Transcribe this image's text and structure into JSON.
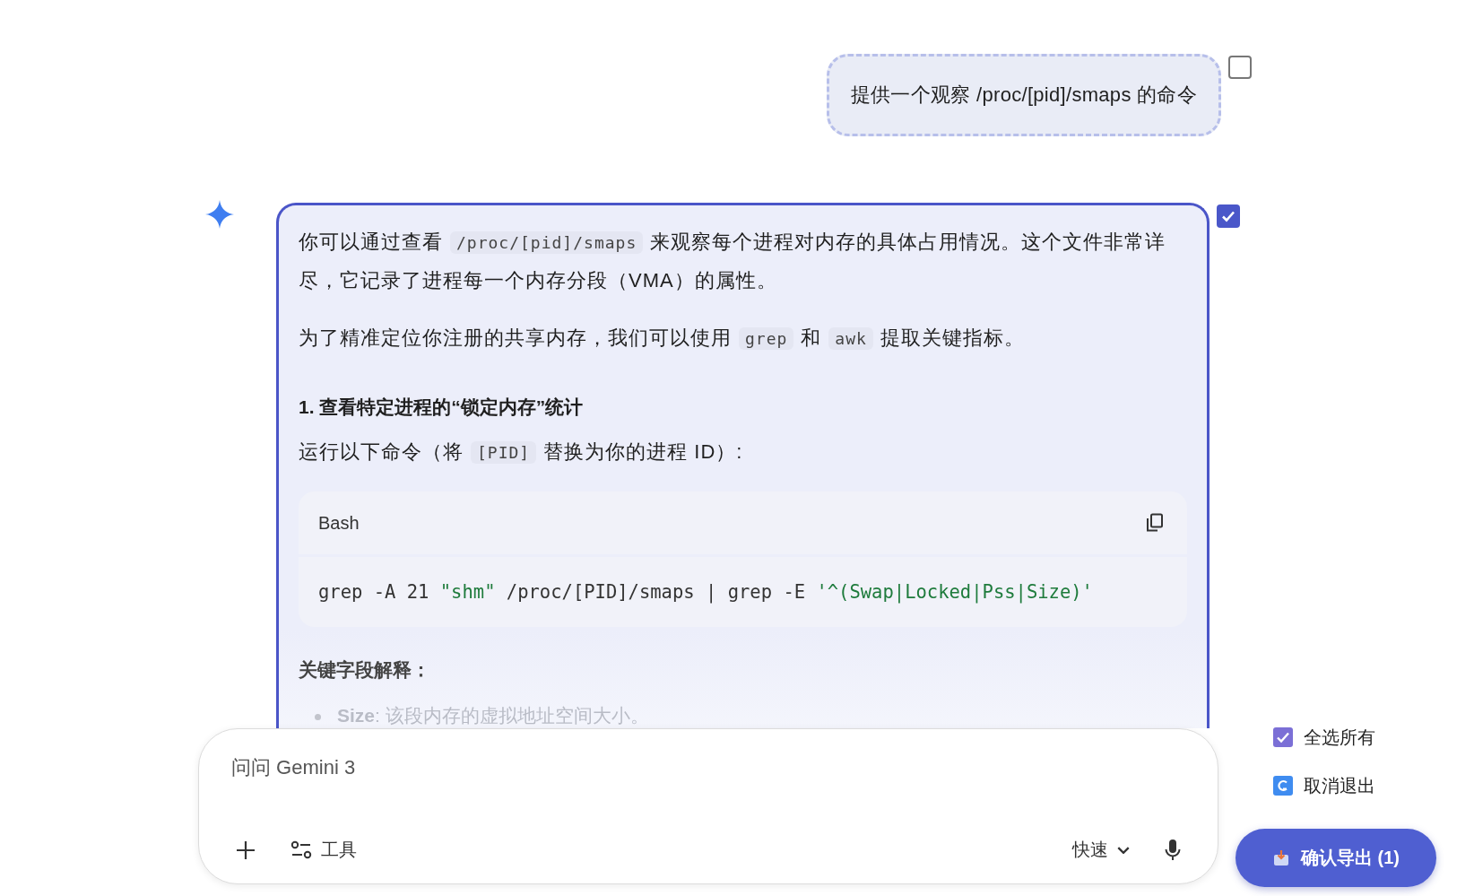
{
  "user_message": {
    "text": "提供一个观察 /proc/[pid]/smaps 的命令",
    "selected": false
  },
  "response": {
    "selected": true,
    "blocks": [
      {
        "kind": "paragraph",
        "parts": [
          {
            "kind": "text",
            "text": "你可以通过查看"
          },
          {
            "kind": "code",
            "text": "/proc/[pid]/smaps"
          },
          {
            "kind": "text",
            "text": "来观察每个进程对内存的具体占用情况。这个文件非常详尽，它记录了进程每一个内存分段（VMA）的属性。"
          }
        ]
      },
      {
        "kind": "paragraph",
        "parts": [
          {
            "kind": "text",
            "text": "为了精准定位你注册的共享内存，我们可以使用"
          },
          {
            "kind": "code",
            "text": "grep"
          },
          {
            "kind": "text",
            "text": "和"
          },
          {
            "kind": "code",
            "text": "awk"
          },
          {
            "kind": "text",
            "text": "提取关键指标。"
          }
        ]
      },
      {
        "kind": "heading",
        "text": "1. 查看特定进程的“锁定内存”统计"
      },
      {
        "kind": "paragraph",
        "parts": [
          {
            "kind": "text",
            "text": "运行以下命令（将"
          },
          {
            "kind": "code",
            "text": "[PID]"
          },
          {
            "kind": "text",
            "text": "替换为你的进程 ID）:"
          }
        ]
      },
      {
        "kind": "codeblock",
        "language": "Bash",
        "tokens": [
          {
            "kind": "plain",
            "text": "grep -A 21 "
          },
          {
            "kind": "string",
            "text": "\"shm\""
          },
          {
            "kind": "plain",
            "text": " /proc/[PID]/smaps | grep -E "
          },
          {
            "kind": "string",
            "text": "'^(Swap|Locked|Pss|Size)'"
          }
        ]
      },
      {
        "kind": "subheading",
        "text": "关键字段解释："
      },
      {
        "kind": "bullet",
        "text": "**Size**: 该段内存的虚拟地址空间大小。"
      }
    ]
  },
  "composer": {
    "placeholder": "问问 Gemini 3",
    "tools_label": "工具",
    "mode": "快速"
  },
  "export_panel": {
    "actions": [
      {
        "kind": "select_all",
        "label": "全选所有",
        "checked": true
      },
      {
        "kind": "cancel",
        "label": "取消退出"
      }
    ],
    "confirm": "确认导出 (1)"
  }
}
